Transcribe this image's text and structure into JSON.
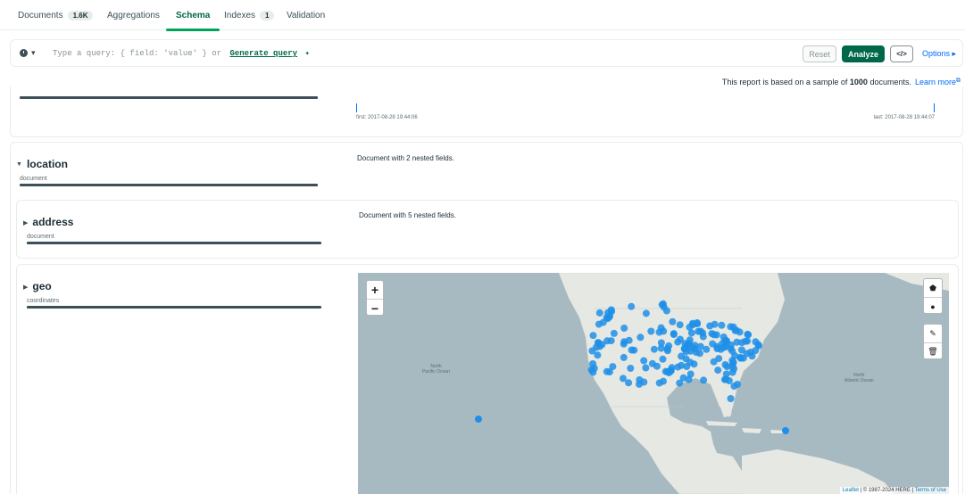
{
  "tabs": [
    {
      "label": "Documents",
      "count": "1.6K"
    },
    {
      "label": "Aggregations"
    },
    {
      "label": "Schema"
    },
    {
      "label": "Indexes",
      "count": "1"
    },
    {
      "label": "Validation"
    }
  ],
  "query": {
    "history_caret": "▾",
    "placeholder": "Type a query: { field: 'value' } or",
    "generate_link": "Generate query",
    "reset_label": "Reset",
    "analyze_label": "Analyze",
    "code_label": "</>",
    "options_label": "Options ▸"
  },
  "report": {
    "prefix": "This report is based on a sample of ",
    "count": "1000",
    "suffix": " documents.",
    "learn_more": "Learn more"
  },
  "date_range": {
    "first": "first: 2017-08-28 19:44:06",
    "last": "last: 2017-08-28 19:44:07"
  },
  "fields": {
    "location": {
      "name": "location",
      "type": "document",
      "desc": "Document with 2 nested fields."
    },
    "address": {
      "name": "address",
      "type": "document",
      "desc": "Document with 5 nested fields."
    },
    "geo": {
      "name": "geo",
      "type": "coordinates"
    }
  },
  "map": {
    "zoom_in": "+",
    "zoom_out": "−",
    "attribution_leaflet": "Leaflet",
    "attribution_rest": " | © 1987-2024 HERE | ",
    "attribution_terms": "Terms of Use",
    "pacific": "North\nPacific Ocean",
    "atlantic": "North\nAtlantic Ocean",
    "point_color": "#1f8fe8"
  },
  "colors": {
    "brand_green": "#00684a",
    "link_blue": "#016bf8"
  }
}
